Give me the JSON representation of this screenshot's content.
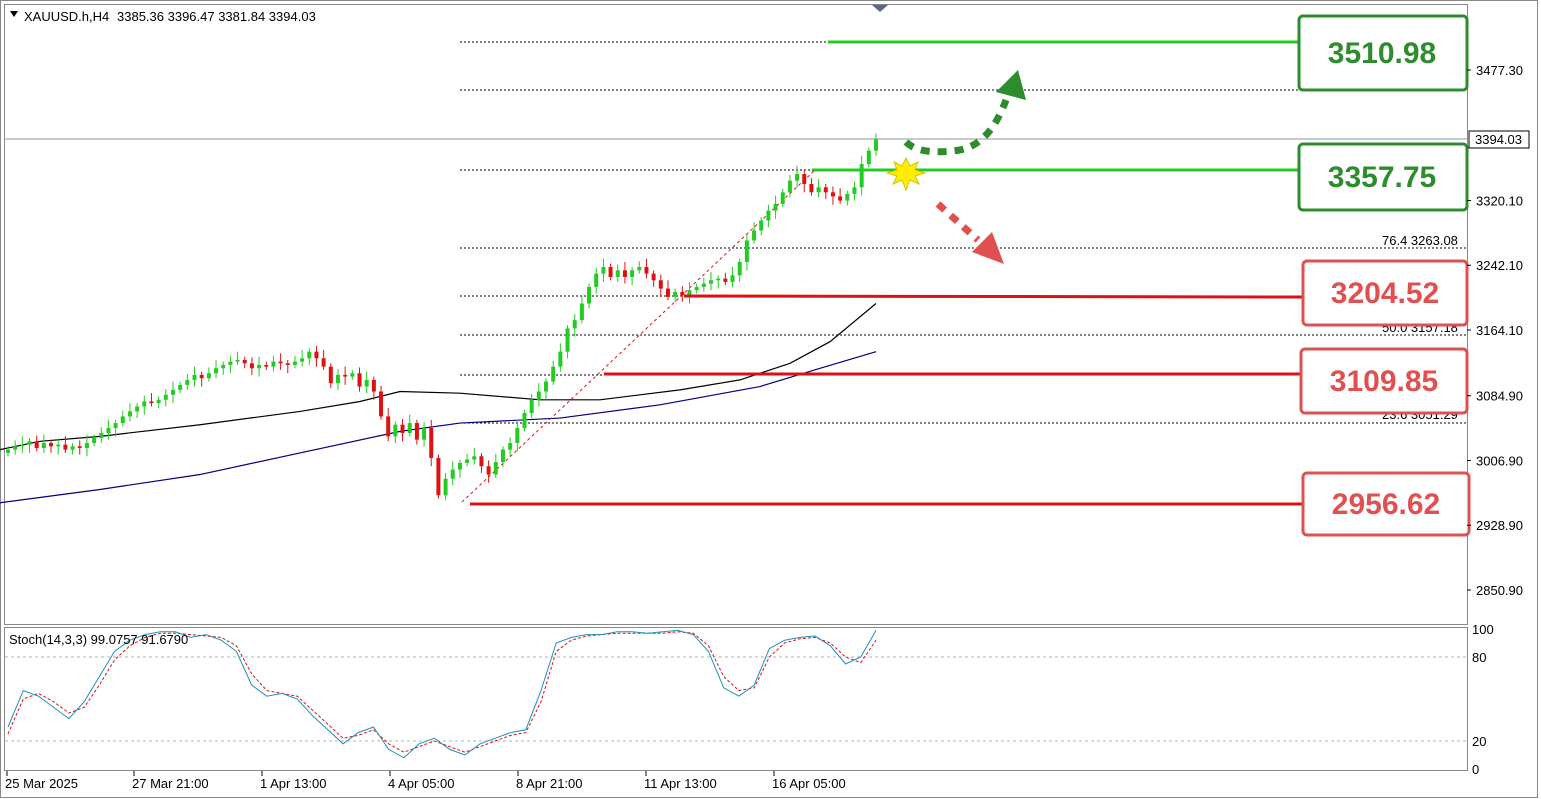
{
  "header": {
    "symbol": "XAUUSD.h,H4",
    "ohlc": "3385.36 3396.47 3381.84 3394.03"
  },
  "stoch_label": "Stoch(14,3,3) 99.0757 91.6790",
  "current_price": "3394.03",
  "colors": {
    "bull": "#22cc22",
    "bear": "#dd1111",
    "support_line": "#dd1111",
    "resistance_line": "#22cc22",
    "box_green_border": "#2e8b2e",
    "box_green_text": "#2e8b2e",
    "box_red_border": "#e05050",
    "box_red_text": "#e05050",
    "ma_fast": "#000000",
    "ma_slow": "#000080",
    "stoch_main": "#1e90c0",
    "stoch_signal": "#dd1111"
  },
  "levels": [
    {
      "value": "3510.98",
      "kind": "resistance"
    },
    {
      "value": "3357.75",
      "kind": "resistance"
    },
    {
      "value": "3204.52",
      "kind": "support"
    },
    {
      "value": "3109.85",
      "kind": "support"
    },
    {
      "value": "2956.62",
      "kind": "support"
    }
  ],
  "fib_labels": [
    "76.4 3263.08",
    "50.0 3157.18",
    "23.6 3051.29"
  ],
  "chart_data": {
    "type": "candlestick",
    "price_axis": {
      "ticks": [
        "3477.30",
        "3320.10",
        "3242.10",
        "3164.10",
        "3084.90",
        "3006.90",
        "2928.90",
        "2850.90"
      ],
      "range": [
        2820,
        3530
      ]
    },
    "time_axis": {
      "ticks": [
        "25 Mar 2025",
        "27 Mar 21:00",
        "1 Apr 13:00",
        "4 Apr 05:00",
        "8 Apr 21:00",
        "11 Apr 13:00",
        "16 Apr 05:00"
      ]
    },
    "close_path": [
      3020,
      3024,
      3026,
      3030,
      3022,
      3028,
      3024,
      3026,
      3020,
      3024,
      3022,
      3028,
      3034,
      3040,
      3046,
      3052,
      3060,
      3066,
      3072,
      3078,
      3076,
      3080,
      3086,
      3092,
      3098,
      3104,
      3110,
      3106,
      3112,
      3118,
      3122,
      3126,
      3128,
      3124,
      3118,
      3122,
      3120,
      3126,
      3124,
      3122,
      3126,
      3130,
      3138,
      3130,
      3120,
      3100,
      3110,
      3108,
      3112,
      3096,
      3104,
      3090,
      3060,
      3036,
      3050,
      3040,
      3052,
      3032,
      3046,
      3010,
      2965,
      2985,
      2996,
      3004,
      3008,
      3012,
      3000,
      2990,
      3005,
      3020,
      3028,
      3046,
      3064,
      3080,
      3090,
      3102,
      3120,
      3138,
      3166,
      3176,
      3196,
      3216,
      3232,
      3240,
      3228,
      3236,
      3228,
      3236,
      3240,
      3232,
      3224,
      3214,
      3204,
      3210,
      3206,
      3212,
      3216,
      3220,
      3224,
      3226,
      3222,
      3230,
      3246,
      3272,
      3284,
      3296,
      3308,
      3316,
      3330,
      3344,
      3352,
      3340,
      3330,
      3336,
      3330,
      3325,
      3320,
      3328,
      3336,
      3364,
      3380,
      3394
    ],
    "ma_fast": [
      [
        0,
        3020
      ],
      [
        40,
        3030
      ],
      [
        100,
        3036
      ],
      [
        200,
        3050
      ],
      [
        300,
        3066
      ],
      [
        360,
        3078
      ],
      [
        400,
        3090
      ],
      [
        460,
        3088
      ],
      [
        540,
        3080
      ],
      [
        600,
        3080
      ],
      [
        680,
        3092
      ],
      [
        740,
        3104
      ],
      [
        790,
        3124
      ],
      [
        830,
        3150
      ],
      [
        876,
        3196
      ]
    ],
    "ma_slow": [
      [
        0,
        2956
      ],
      [
        100,
        2972
      ],
      [
        200,
        2990
      ],
      [
        300,
        3016
      ],
      [
        400,
        3042
      ],
      [
        460,
        3052
      ],
      [
        560,
        3058
      ],
      [
        660,
        3074
      ],
      [
        760,
        3096
      ],
      [
        820,
        3118
      ],
      [
        876,
        3138
      ]
    ],
    "stoch_axis": {
      "ticks": [
        "100",
        "80",
        "20",
        "0"
      ],
      "range": [
        0,
        100
      ]
    },
    "stoch_main": [
      30,
      56,
      52,
      44,
      36,
      48,
      66,
      84,
      92,
      96,
      98,
      98,
      94,
      96,
      92,
      84,
      60,
      52,
      54,
      50,
      38,
      28,
      18,
      26,
      30,
      14,
      8,
      18,
      22,
      14,
      10,
      18,
      22,
      26,
      28,
      56,
      90,
      94,
      96,
      96,
      98,
      98,
      97,
      98,
      99,
      96,
      84,
      58,
      52,
      60,
      86,
      92,
      94,
      95,
      88,
      75,
      80,
      99
    ],
    "stoch_signal": [
      25,
      50,
      54,
      48,
      40,
      44,
      60,
      78,
      88,
      94,
      97,
      97,
      96,
      95,
      94,
      88,
      68,
      56,
      54,
      52,
      42,
      32,
      22,
      24,
      28,
      18,
      12,
      16,
      20,
      16,
      12,
      16,
      20,
      24,
      26,
      48,
      84,
      92,
      95,
      96,
      97,
      97,
      97,
      97,
      98,
      97,
      88,
      66,
      56,
      58,
      80,
      90,
      93,
      94,
      90,
      80,
      76,
      92
    ]
  }
}
